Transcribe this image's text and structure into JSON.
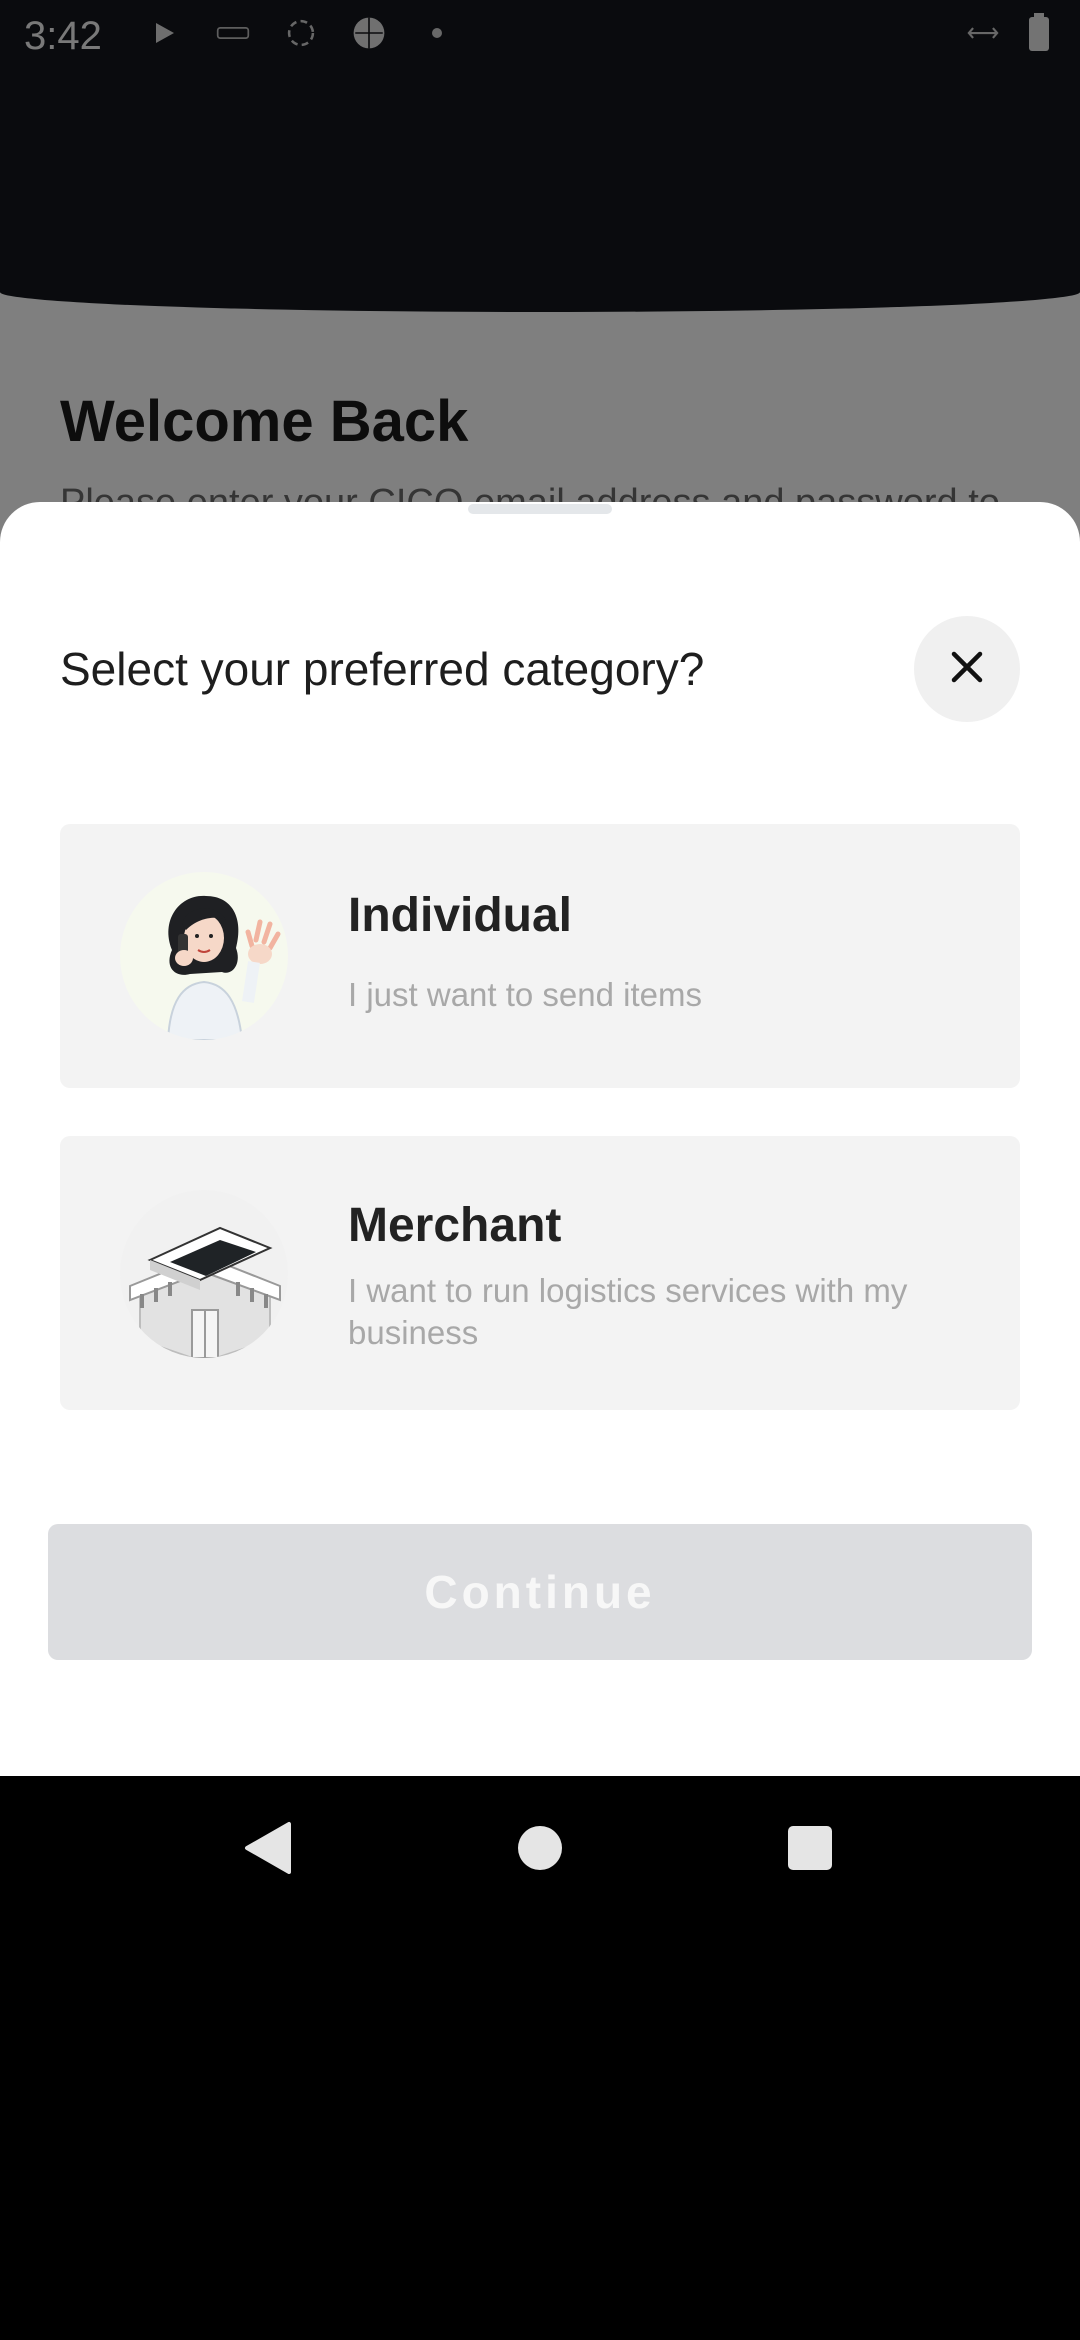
{
  "status_bar": {
    "time": "3:42",
    "icons": [
      "play-icon",
      "notification-icon",
      "sync-icon",
      "globe-icon",
      "dot-icon"
    ],
    "right_icons": [
      "vpn-key-icon",
      "battery-icon"
    ]
  },
  "background_screen": {
    "title": "Welcome Back",
    "subtitle": "Please enter your CICO email address and password to"
  },
  "sheet": {
    "title": "Select your preferred category?",
    "close_icon": "close-icon",
    "options": [
      {
        "title": "Individual",
        "description": "I just want to send items",
        "illustration": "woman-waving-on-phone"
      },
      {
        "title": "Merchant",
        "description": "I want to run logistics services with my business",
        "illustration": "shop-building"
      }
    ],
    "continue_label": "Continue"
  },
  "nav_bar": {
    "back_icon": "back-triangle-icon",
    "home_icon": "home-circle-icon",
    "recents_icon": "recents-square-icon"
  },
  "colors": {
    "header_dark": "#14161c",
    "card_background": "#f3f3f3",
    "button_disabled": "#dcdde0",
    "close_button_bg": "#f0f0f0"
  }
}
